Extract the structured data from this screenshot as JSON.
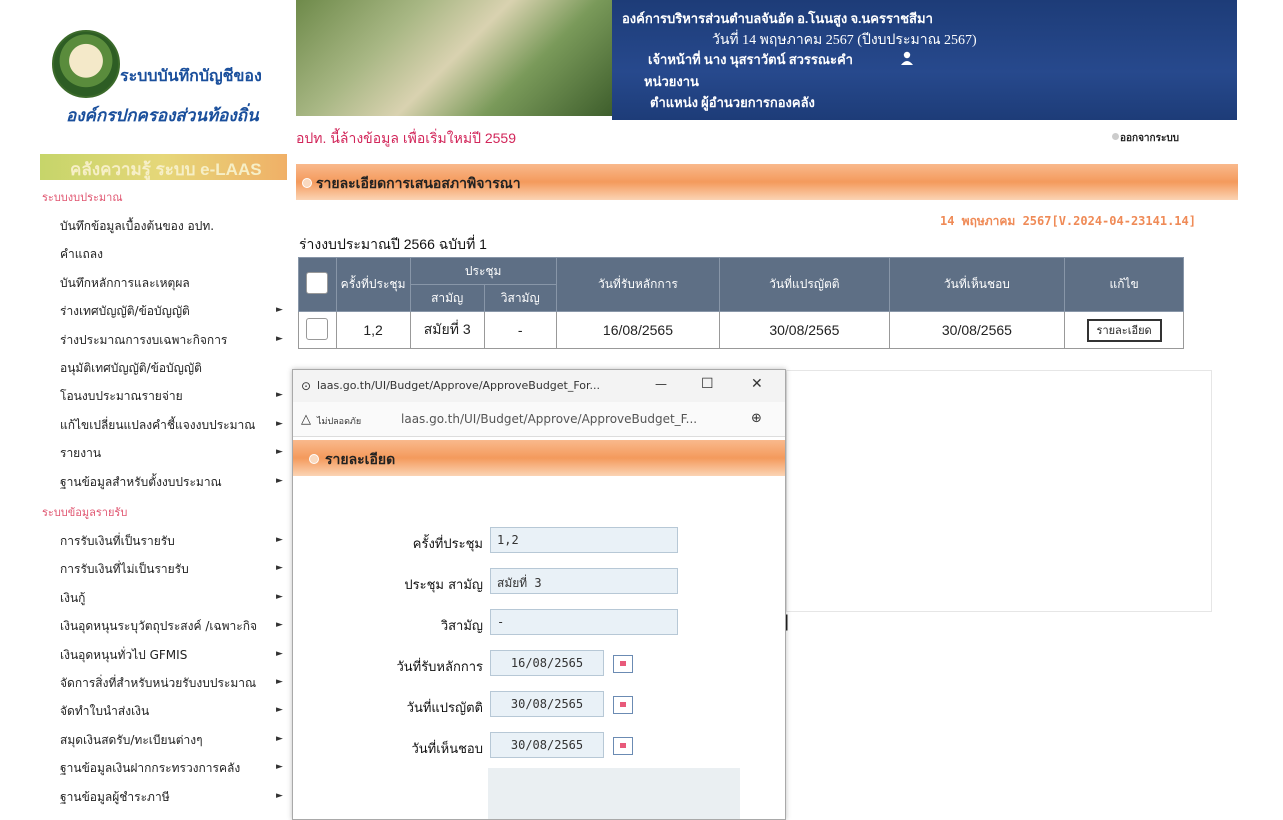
{
  "header": {
    "logo_line1": "ระบบบันทึกบัญชีของ",
    "logo_line2": "องค์กรปกครองส่วนท้องถิ่น",
    "org_line": "องค์การบริหารส่วนตำบลจันอัด อ.โนนสูง จ.นครราชสีมา",
    "date_line": "วันที่ 14 พฤษภาคม 2567  (ปีงบประมาณ 2567)",
    "officer_line": "เจ้าหน้าที่ นาง นุสราวัตน์ สวรรณะคำ",
    "unit_line": "หน่วยงาน",
    "position_line": "ตำแหน่ง ผู้อำนวยการกองคลัง"
  },
  "notice": "อปท. นี้ล้างข้อมูล เพื่อเริ่มใหม่ปี 2559",
  "logout_label": "ออกจากระบบ",
  "sidebar": {
    "banner": "คลังความรู้ ระบบ e-LAAS",
    "group1": "ระบบงบประมาณ",
    "budget_items": [
      {
        "label": "บันทึกข้อมูลเบื้องต้นของ อปท.",
        "arrow": ""
      },
      {
        "label": "คำแถลง",
        "arrow": ""
      },
      {
        "label": "บันทึกหลักการและเหตุผล",
        "arrow": ""
      },
      {
        "label": "ร่างเทศบัญญัติ/ข้อบัญญัติ",
        "arrow": "►"
      },
      {
        "label": "ร่างประมาณการงบเฉพาะกิจการ",
        "arrow": "►"
      },
      {
        "label": "อนุมัติเทศบัญญัติ/ข้อบัญญัติ",
        "arrow": ""
      },
      {
        "label": "โอนงบประมาณรายจ่าย",
        "arrow": "►"
      },
      {
        "label": "แก้ไขเปลี่ยนแปลงคำชี้แจงงบประมาณ",
        "arrow": "►"
      },
      {
        "label": "รายงาน",
        "arrow": "►"
      },
      {
        "label": "ฐานข้อมูลสำหรับตั้งงบประมาณ",
        "arrow": "►"
      }
    ],
    "group2": "ระบบข้อมูลรายรับ",
    "revenue_items": [
      {
        "label": "การรับเงินที่เป็นรายรับ",
        "arrow": "►"
      },
      {
        "label": "การรับเงินที่ไม่เป็นรายรับ",
        "arrow": "►"
      },
      {
        "label": "เงินกู้",
        "arrow": "►"
      },
      {
        "label": "เงินอุดหนุนระบุวัตถุประสงค์ /เฉพาะกิจ",
        "arrow": "►"
      },
      {
        "label": "เงินอุดหนุนทั่วไป GFMIS",
        "arrow": "►"
      },
      {
        "label": "จัดการสิ่งที่สำหรับหน่วยรับงบประมาณ",
        "arrow": "►"
      },
      {
        "label": "จัดทำใบนำส่งเงิน",
        "arrow": "►"
      },
      {
        "label": "สมุดเงินสดรับ/ทะเบียนต่างๆ",
        "arrow": "►"
      },
      {
        "label": "ฐานข้อมูลเงินฝากกระทรวงการคลัง",
        "arrow": "►"
      },
      {
        "label": "ฐานข้อมูลผู้ชำระภาษี",
        "arrow": "►"
      }
    ]
  },
  "section_title": "รายละเอียดการเสนอสภาพิจารณา",
  "date_version": "14 พฤษภาคม 2567[V.2024-04-23141.14]",
  "draft_title": "ร่างงบประมาณปี 2566 ฉบับที่ 1",
  "table": {
    "headers": {
      "meeting_no": "ครั้งที่ประชุม",
      "meeting": "ประชุม",
      "ordinary": "สามัญ",
      "extraordinary": "วิสามัญ",
      "received": "วันที่รับหลักการ",
      "translated": "วันที่แปรญัตติ",
      "approved": "วันที่เห็นชอบ",
      "edit": "แก้ไข"
    },
    "row": {
      "meeting_no": "1,2",
      "ordinary": "สมัยที่ 3",
      "extraordinary": "-",
      "received": "16/08/2565",
      "translated": "30/08/2565",
      "approved": "30/08/2565",
      "button": "รายละเอียด"
    }
  },
  "popup": {
    "title": "laas.go.th/UI/Budget/Approve/ApproveBudget_For...",
    "minimize": "—",
    "maximize": "☐",
    "close": "✕",
    "insecure": "ไม่ปลอดภัย",
    "url": "laas.go.th/UI/Budget/Approve/ApproveBudget_F...",
    "section_title": "รายละเอียด",
    "fields": {
      "meeting_no_label": "ครั้งที่ประชุม",
      "meeting_no_value": "1,2",
      "ordinary_label": "ประชุม สามัญ",
      "ordinary_value": "สมัยที่ 3",
      "extra_label": "วิสามัญ",
      "extra_value": "-",
      "received_label": "วันที่รับหลักการ",
      "received_value": "16/08/2565",
      "translated_label": "วันที่แปรญัตติ",
      "translated_value": "30/08/2565",
      "approved_label": "วันที่เห็นชอบ",
      "approved_value": "30/08/2565"
    }
  },
  "colors": {
    "header_blue": "#27498d",
    "table_header": "#5e6f85",
    "section_orange": "#f49a5c",
    "notice_red": "#d2265a"
  }
}
